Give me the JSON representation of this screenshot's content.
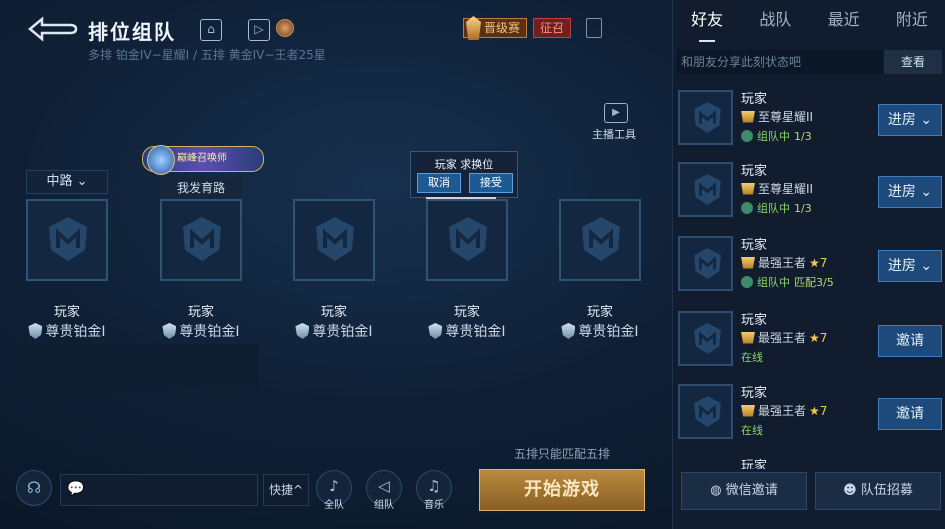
{
  "header": {
    "title": "排位组队",
    "subtitle": "多排 铂金IV−星耀I / 五排 黄金IV−王者25星",
    "tag_jinji": "晋级赛",
    "tag_zhengzhao": "征召"
  },
  "streamer": {
    "label": "主播工具"
  },
  "slots": {
    "role_select": "中路 ⌄",
    "badge_text": "巅峰召唤师",
    "lane_text": "我发育路",
    "players": [
      {
        "name": "玩家",
        "rank": "尊贵铂金I"
      },
      {
        "name": "玩家",
        "rank": "尊贵铂金I"
      },
      {
        "name": "玩家",
        "rank": "尊贵铂金I"
      },
      {
        "name": "玩家",
        "rank": "尊贵铂金I"
      },
      {
        "name": "玩家",
        "rank": "尊贵铂金I"
      }
    ]
  },
  "swap_popup": {
    "title": "玩家 求换位",
    "cancel": "取消",
    "accept": "接受"
  },
  "bottom": {
    "quick": "快捷^",
    "voice_all": "全队",
    "voice_team": "组队",
    "voice_music": "音乐",
    "match_hint": "五排只能匹配五排",
    "start": "开始游戏"
  },
  "panel": {
    "tabs": [
      "好友",
      "战队",
      "最近",
      "附近"
    ],
    "share_placeholder": "和朋友分享此刻状态吧",
    "view": "查看",
    "friends": [
      {
        "name": "玩家",
        "rank": "至尊星耀II",
        "stars": "",
        "status": "组队中",
        "extra": "1/3",
        "action": "进房 ⌄",
        "rank_kind": "xingyao"
      },
      {
        "name": "玩家",
        "rank": "至尊星耀II",
        "stars": "",
        "status": "组队中",
        "extra": "1/3",
        "action": "进房 ⌄",
        "rank_kind": "xingyao"
      },
      {
        "name": "玩家",
        "rank": "最强王者",
        "stars": "★7",
        "status": "组队中",
        "extra": "匹配3/5",
        "action": "进房 ⌄",
        "rank_kind": "wangzhe"
      },
      {
        "name": "玩家",
        "rank": "最强王者",
        "stars": "★7",
        "status": "在线",
        "extra": "",
        "action": "邀请",
        "rank_kind": "wangzhe"
      },
      {
        "name": "玩家",
        "rank": "最强王者",
        "stars": "★7",
        "status": "在线",
        "extra": "",
        "action": "邀请",
        "rank_kind": "wangzhe"
      }
    ],
    "peek_name": "玩家",
    "wechat_invite": "微信邀请",
    "team_recruit": "队伍招募"
  },
  "colors": {
    "accent": "#1d4a7a",
    "gold": "#b98a3e",
    "online": "#8dd46b"
  }
}
